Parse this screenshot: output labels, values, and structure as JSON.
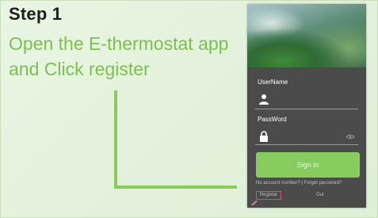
{
  "step": {
    "title": "Step 1",
    "instruction": "Open the E-thermostat app and Click register"
  },
  "phone": {
    "username_label": "UserName",
    "password_label": "PassWord",
    "signin_label": "Sign in",
    "links_text": "No account number? | Forget password?",
    "register_label": "Register",
    "other_label": "Out"
  },
  "colors": {
    "accent_green": "#7cc14e",
    "signin_green": "#86cc5f",
    "highlight_red": "#e05050"
  }
}
